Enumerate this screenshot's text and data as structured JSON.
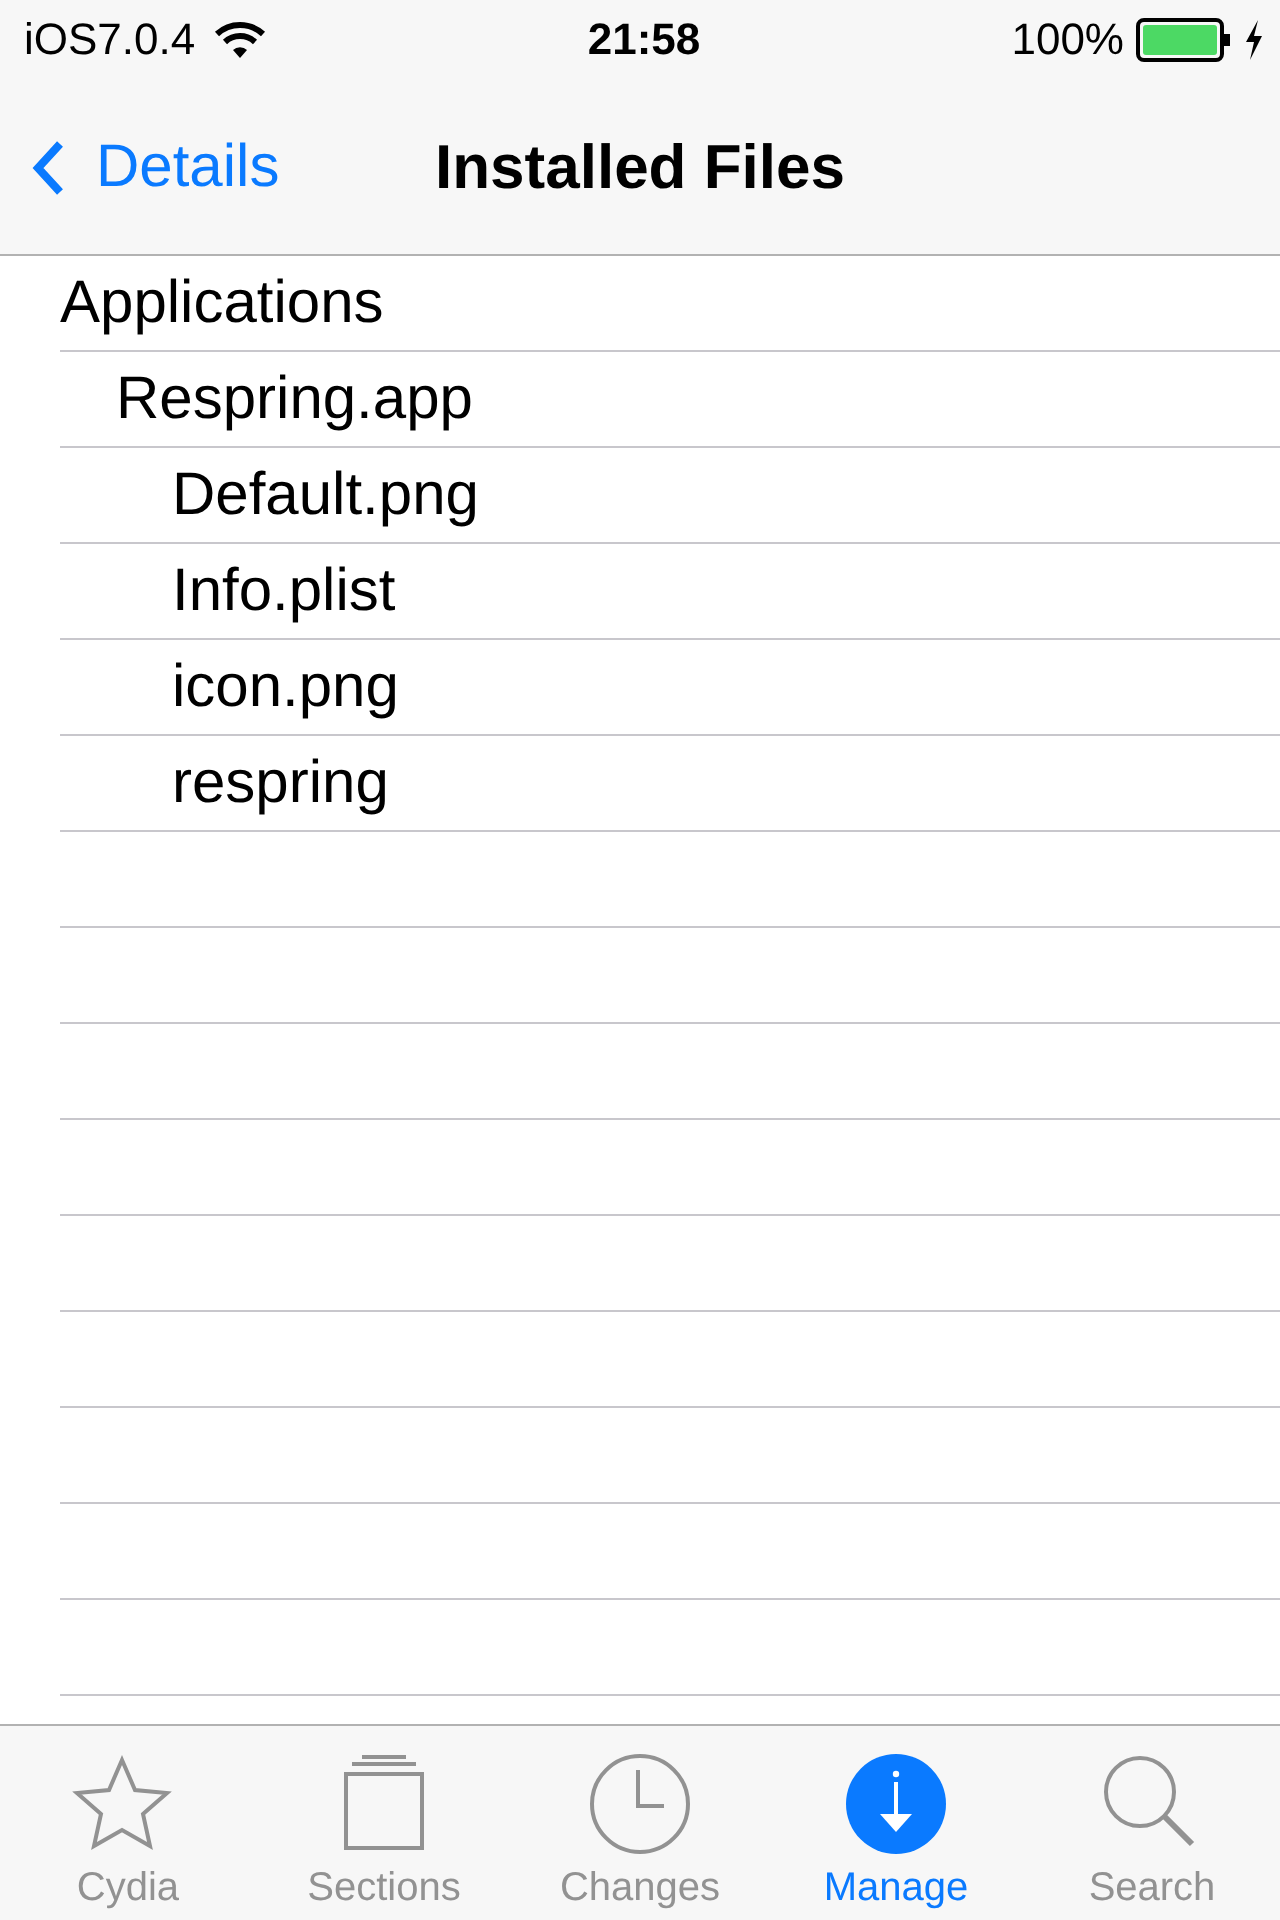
{
  "status_bar": {
    "carrier": "iOS7.0.4",
    "time": "21:58",
    "battery": "100%",
    "charging": true
  },
  "nav_bar": {
    "back": "Details",
    "title": "Installed Files"
  },
  "files": [
    {
      "name": "Applications",
      "children": [
        {
          "name": "Respring.app",
          "children": [
            {
              "name": "Default.png"
            },
            {
              "name": "Info.plist"
            },
            {
              "name": "icon.png"
            },
            {
              "name": "respring"
            }
          ]
        }
      ]
    }
  ],
  "tabs": [
    {
      "label": "Cydia",
      "kind": "star",
      "selected": false
    },
    {
      "label": "Sections",
      "kind": "sections",
      "selected": false
    },
    {
      "label": "Changes",
      "kind": "clock",
      "selected": false
    },
    {
      "label": "Manage",
      "kind": "manage",
      "selected": true
    },
    {
      "label": "Search",
      "kind": "search",
      "selected": false
    }
  ]
}
